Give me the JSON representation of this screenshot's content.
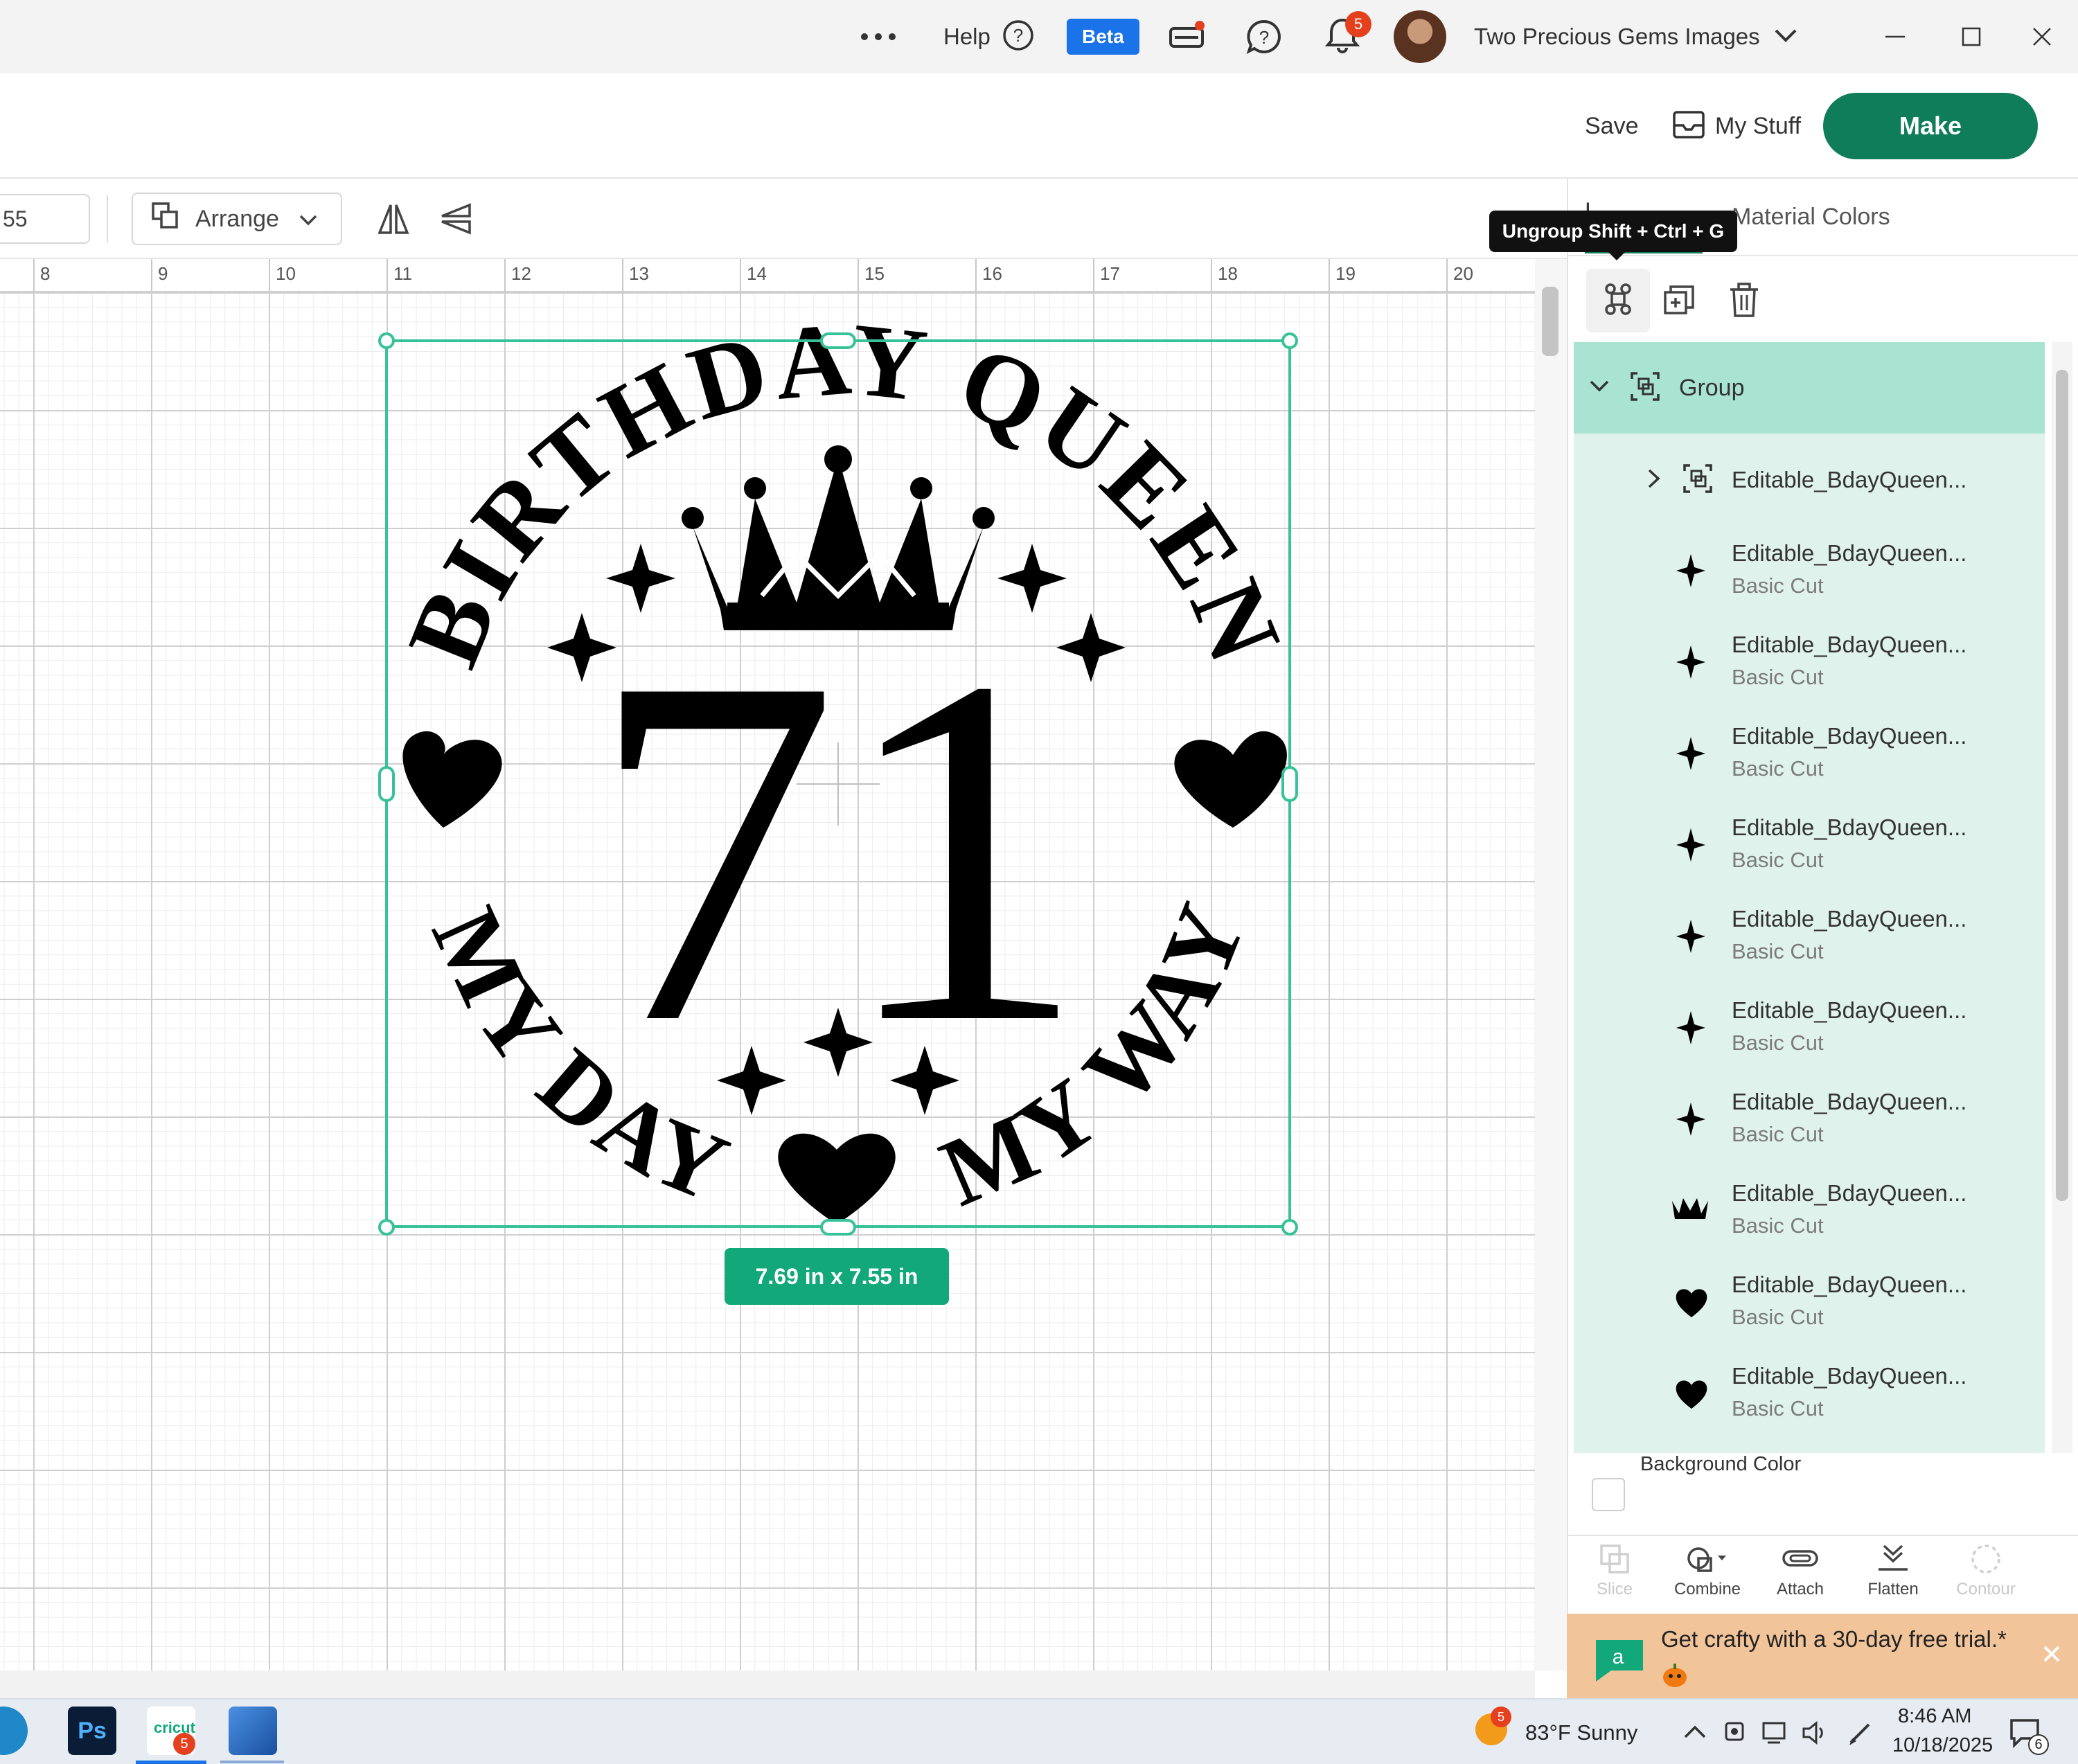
{
  "titlebar": {
    "help_label": "Help",
    "beta_label": "Beta",
    "notification_count": "5",
    "account_name": "Two Precious Gems Images"
  },
  "header": {
    "save_label": "Save",
    "mystuff_label": "My Stuff",
    "make_label": "Make"
  },
  "toolbar": {
    "size_value": "55",
    "arrange_label": "Arrange"
  },
  "ruler": {
    "ticks": [
      "8",
      "9",
      "10",
      "11",
      "12",
      "13",
      "14",
      "15",
      "16",
      "17",
      "18",
      "19",
      "20"
    ]
  },
  "design": {
    "top_text": "BIRTHDAY QUEEN",
    "bottom_left_text": "MY DAY",
    "bottom_right_text": "MY WAY",
    "number": "71"
  },
  "selection": {
    "size_label": "7.69  in x 7.55  in"
  },
  "panel": {
    "tab_layers_partial": "L",
    "tab_colors": "Material Colors",
    "tooltip": "Ungroup Shift + Ctrl + G",
    "group_label": "Group",
    "layers": [
      {
        "name": "Editable_BdayQueen...",
        "sub": "",
        "icon": "group-icon"
      },
      {
        "name": "Editable_BdayQueen...",
        "sub": "Basic Cut",
        "icon": "sparkle-icon"
      },
      {
        "name": "Editable_BdayQueen...",
        "sub": "Basic Cut",
        "icon": "sparkle-icon"
      },
      {
        "name": "Editable_BdayQueen...",
        "sub": "Basic Cut",
        "icon": "sparkle-icon"
      },
      {
        "name": "Editable_BdayQueen...",
        "sub": "Basic Cut",
        "icon": "sparkle-icon"
      },
      {
        "name": "Editable_BdayQueen...",
        "sub": "Basic Cut",
        "icon": "sparkle-icon"
      },
      {
        "name": "Editable_BdayQueen...",
        "sub": "Basic Cut",
        "icon": "sparkle-icon"
      },
      {
        "name": "Editable_BdayQueen...",
        "sub": "Basic Cut",
        "icon": "sparkle-icon"
      },
      {
        "name": "Editable_BdayQueen...",
        "sub": "Basic Cut",
        "icon": "crown-icon"
      },
      {
        "name": "Editable_BdayQueen...",
        "sub": "Basic Cut",
        "icon": "heart-icon"
      },
      {
        "name": "Editable_BdayQueen...",
        "sub": "Basic Cut",
        "icon": "heart-icon"
      }
    ],
    "background_color_label": "Background Color",
    "actions": [
      "Slice",
      "Combine",
      "Attach",
      "Flatten",
      "Contour"
    ],
    "promo_text": "Get crafty with a 30-day free trial.*"
  },
  "taskbar": {
    "cricut_badge": "5",
    "weather_badge": "5",
    "weather": "83°F  Sunny",
    "time": "8:46 AM",
    "date": "10/18/2025",
    "notif_count": "6"
  },
  "colors": {
    "accent_green": "#0f7d5a",
    "selection_green": "#39c29a",
    "layer_bg": "#dff2ec",
    "beta_blue": "#1a73e8"
  }
}
